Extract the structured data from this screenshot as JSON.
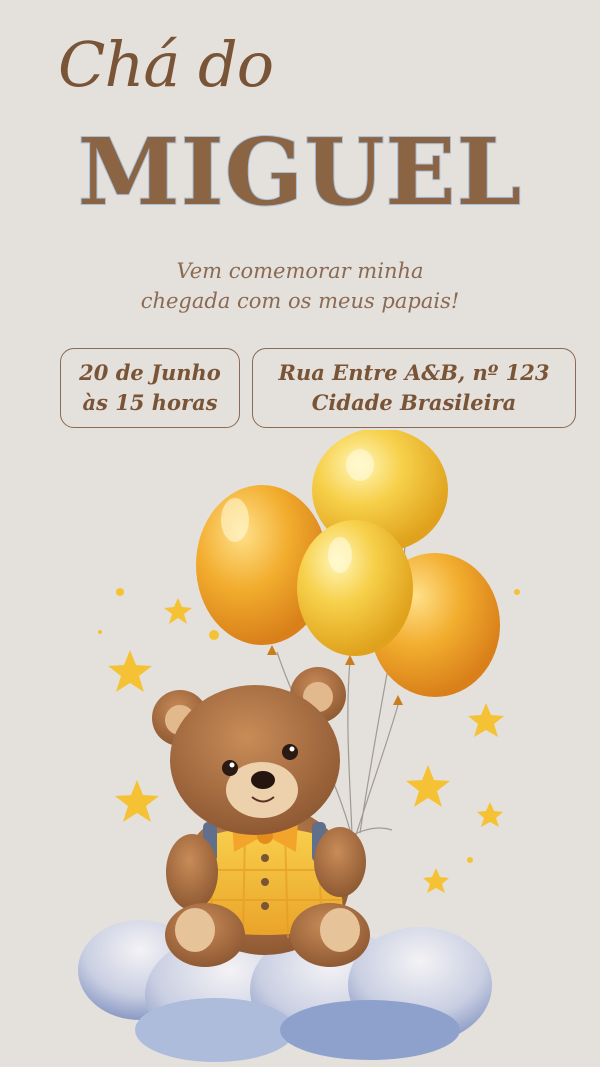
{
  "invite": {
    "title_script": "Chá do",
    "title_name": "MIGUEL",
    "subtitle_line1": "Vem comemorar minha",
    "subtitle_line2": "chegada com os meus papais!",
    "date_line1": "20 de Junho",
    "date_line2": "às 15 horas",
    "location_line1": "Rua Entre A&B, nº 123",
    "location_line2": "Cidade Brasileira"
  },
  "illustration": {
    "subject": "teddy-bear-with-balloons",
    "icons": [
      "star-icon",
      "balloon-icon",
      "cloud-icon"
    ]
  },
  "colors": {
    "background": "#e4e0db",
    "text_brown": "#7a5436",
    "name_outline": "#a9bfd8",
    "balloon_yellow": "#f5c542",
    "balloon_orange": "#f0a32a",
    "bear_brown": "#a86a3c"
  }
}
